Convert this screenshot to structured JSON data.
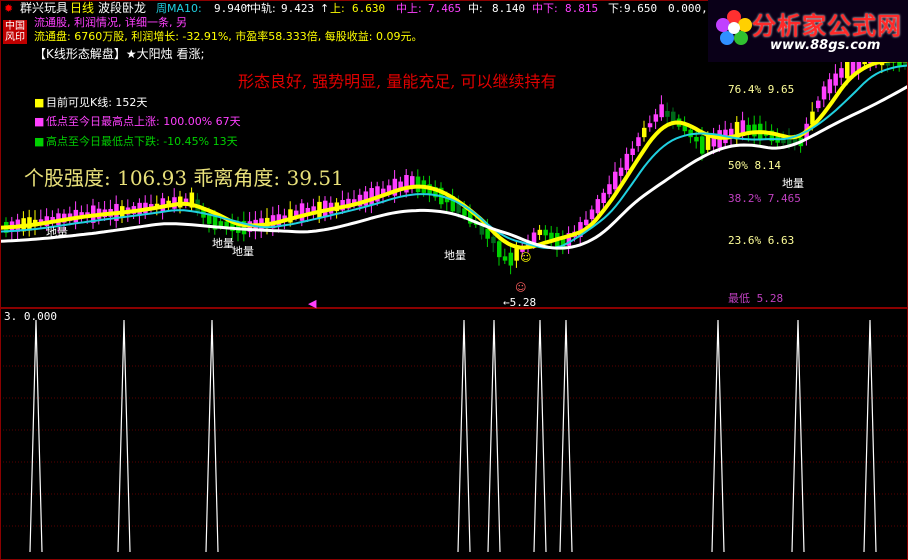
{
  "header": {
    "app_name": "群兴玩具",
    "period": "日线",
    "indicator": "波段卧龙",
    "ma_label": "周MA10:",
    "ma_value": "9.940",
    "mid_label": "中轨:",
    "mid_value": "9.423",
    "up_label": "上:",
    "up_value": "6.630",
    "zhongshang_label": "中上:",
    "zhongshang_value": "7.465",
    "zhong_label": "中:",
    "zhong_value": "8.140",
    "zhongxia_label": "中下:",
    "zhongxia_value": "8.815",
    "xia_label": "下:",
    "xia_value": "9.650",
    "xia_value2": "0.000,"
  },
  "badge": {
    "line1": "中国",
    "line2": "风印"
  },
  "info": {
    "row2_pink": "流通股, 利润情况, 详细一条, 另",
    "circulation": "流通盘: 6760万股, 利润增长: -32.91%, 市盈率58.333倍, 每股收益: 0.09元。",
    "kline_title": "【K线形态解盘】★大阳烛 看涨;",
    "red_comment": "形态良好, 强势明显, 量能充足, 可以继续持有",
    "visible_bars": "目前可见K线: 152天",
    "low_to_high": "低点至今日最高点上涨: 100.00% 67天",
    "high_to_low": "高点至今日最低点下跌: -10.45% 13天",
    "strength": "个股强度: 106.93  乖离角度: 39.51"
  },
  "fib": {
    "l1": "76.4%  9.65",
    "l2": "50%  8.14",
    "l3": "38.2%  7.465",
    "l4": "23.6%  6.63",
    "lowest": "最低  5.28"
  },
  "markers": {
    "diliang": "地量",
    "low_arrow": "←5.28",
    "sub_value": "3. 0.000"
  },
  "logo": {
    "title": "分析家公式网",
    "url": "www.88gs.com"
  },
  "colors": {
    "yellow": "#ffff00",
    "magenta": "#ff40ff",
    "green": "#00d000",
    "cyan": "#20d0e0",
    "white": "#ffffff",
    "red": "#ff0000",
    "dark_green": "#006a1a"
  }
}
